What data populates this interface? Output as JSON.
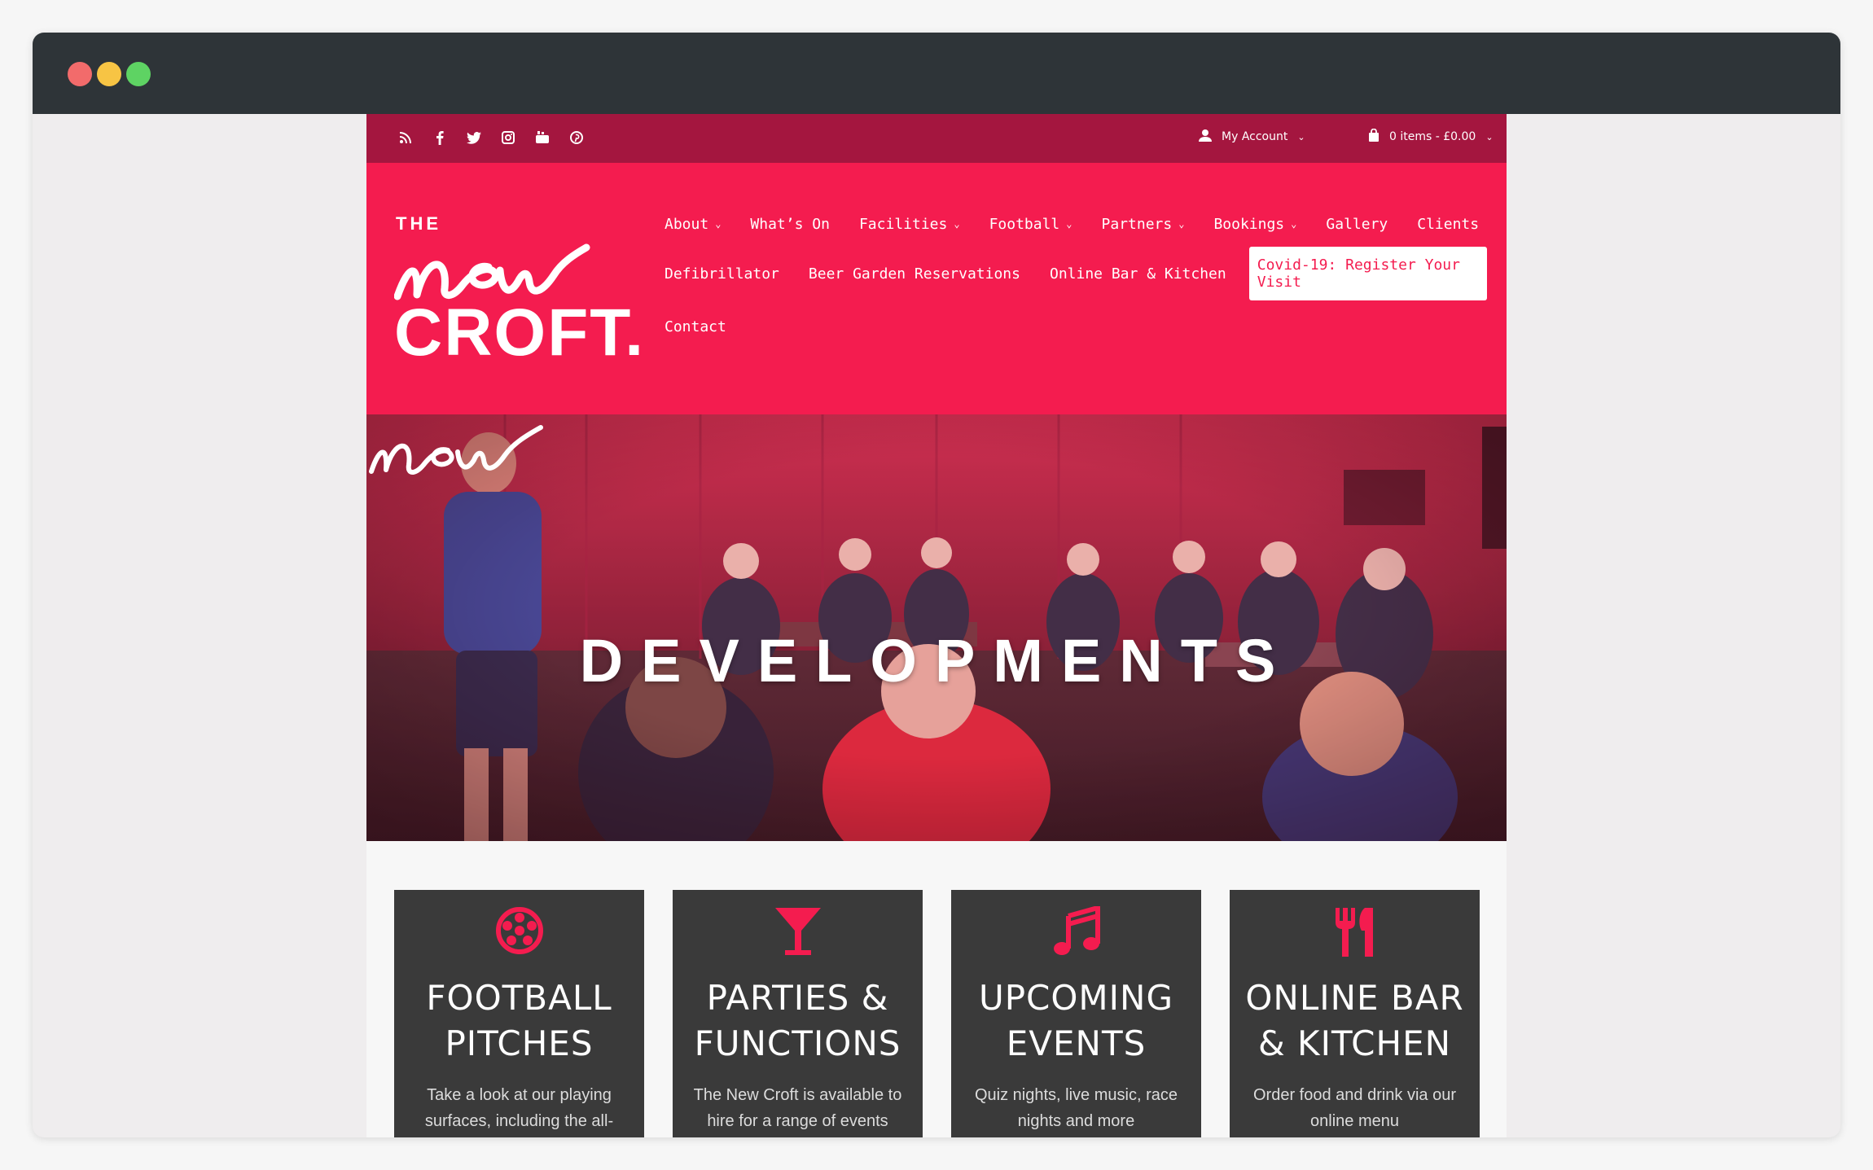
{
  "topbar": {
    "social_icons": [
      "rss-icon",
      "facebook-icon",
      "twitter-icon",
      "instagram-icon",
      "youtube-icon",
      "pinterest-icon"
    ],
    "account_label": "My Account",
    "cart_label": "0 items - £0.00"
  },
  "logo": {
    "the": "THE",
    "croft": "CROFT."
  },
  "nav": {
    "row1": [
      {
        "label": "About",
        "dropdown": true
      },
      {
        "label": "What’s On",
        "dropdown": false
      },
      {
        "label": "Facilities",
        "dropdown": true
      },
      {
        "label": "Football",
        "dropdown": true
      },
      {
        "label": "Partners",
        "dropdown": true
      },
      {
        "label": "Bookings",
        "dropdown": true
      },
      {
        "label": "Gallery",
        "dropdown": false
      },
      {
        "label": "Clients",
        "dropdown": false
      }
    ],
    "row2": [
      {
        "label": "Defibrillator"
      },
      {
        "label": "Beer Garden Reservations"
      },
      {
        "label": "Online Bar & Kitchen"
      }
    ],
    "covid_button": "Covid-19: Register Your Visit",
    "row3": [
      {
        "label": "Contact"
      }
    ]
  },
  "hero": {
    "title": "DEVELOPMENTS"
  },
  "cards": [
    {
      "icon": "football-icon",
      "title_line1": "FOOTBALL",
      "title_line2": "PITCHES",
      "text": "Take a look at our playing surfaces, including the all-"
    },
    {
      "icon": "cocktail-icon",
      "title_line1": "PARTIES &",
      "title_line2": "FUNCTIONS",
      "text": "The New Croft is available to hire for a range of events"
    },
    {
      "icon": "music-note-icon",
      "title_line1": "UPCOMING",
      "title_line2": "EVENTS",
      "text": "Quiz nights, live music, race nights and more"
    },
    {
      "icon": "cutlery-icon",
      "title_line1": "ONLINE BAR",
      "title_line2": "& KITCHEN",
      "text": "Order food and drink via our online menu"
    }
  ],
  "colors": {
    "brand_pink": "#f41c4f",
    "topbar_crimson": "#a4163f",
    "card_dark": "#3a3a3a",
    "browser_chrome": "#2e3438"
  }
}
